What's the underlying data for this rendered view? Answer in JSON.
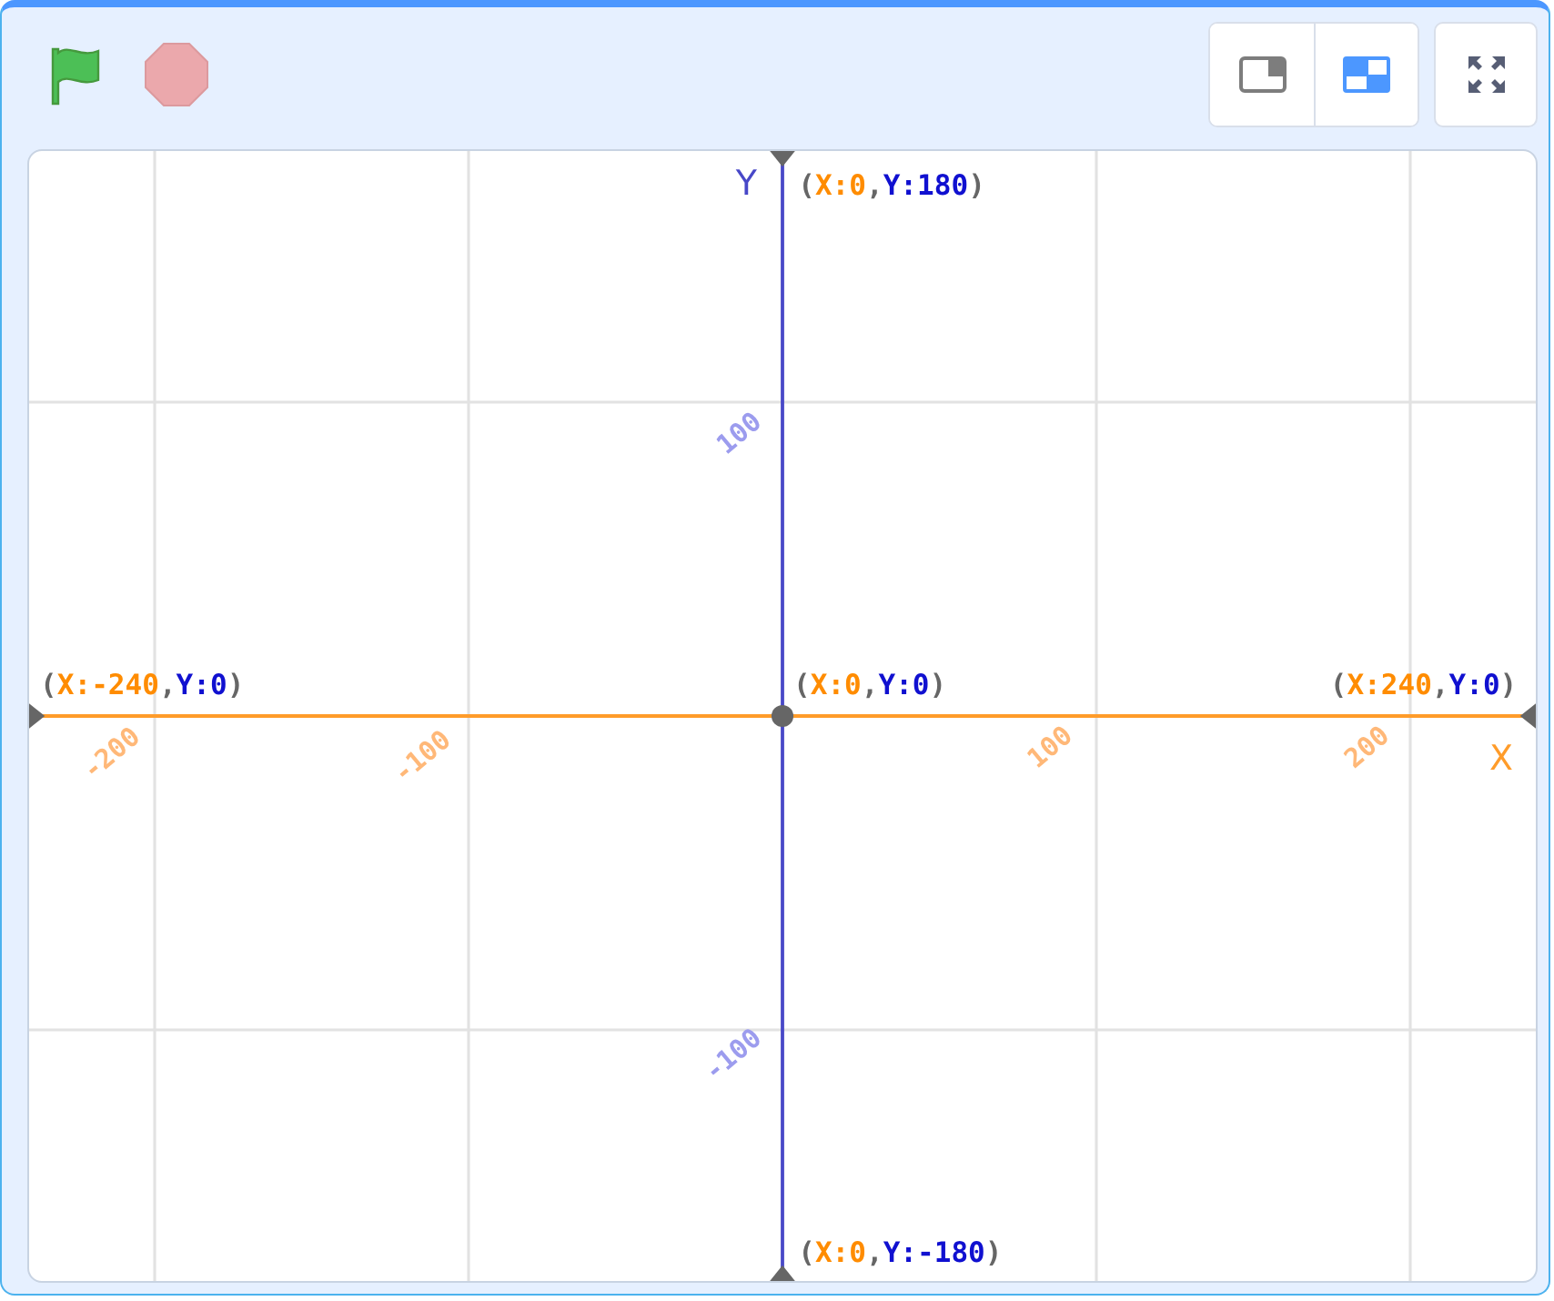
{
  "stage_size_buttons": [
    {
      "selected": false
    },
    {
      "selected": true
    }
  ],
  "stage": {
    "axes": [
      {
        "kind": "y",
        "label": "Y"
      },
      {
        "kind": "x",
        "label": "X"
      }
    ],
    "ticks": [
      {
        "kind": "y",
        "text": "100"
      },
      {
        "kind": "y",
        "text": "-100"
      },
      {
        "kind": "x",
        "text": "-200"
      },
      {
        "kind": "x",
        "text": "-100"
      },
      {
        "kind": "x",
        "text": "100"
      },
      {
        "kind": "x",
        "text": "200"
      }
    ],
    "points": [
      {
        "parts": [
          {
            "kind": "punct",
            "text": "("
          },
          {
            "kind": "x",
            "text": "X:0"
          },
          {
            "kind": "punct",
            "text": ","
          },
          {
            "kind": "y",
            "text": "Y:180"
          },
          {
            "kind": "punct",
            "text": ")"
          }
        ]
      },
      {
        "parts": [
          {
            "kind": "punct",
            "text": "("
          },
          {
            "kind": "x",
            "text": "X:-240"
          },
          {
            "kind": "punct",
            "text": ","
          },
          {
            "kind": "y",
            "text": "Y:0"
          },
          {
            "kind": "punct",
            "text": ")"
          }
        ]
      },
      {
        "parts": [
          {
            "kind": "punct",
            "text": "("
          },
          {
            "kind": "x",
            "text": "X:0"
          },
          {
            "kind": "punct",
            "text": ","
          },
          {
            "kind": "y",
            "text": "Y:0"
          },
          {
            "kind": "punct",
            "text": ")"
          }
        ]
      },
      {
        "parts": [
          {
            "kind": "punct",
            "text": "("
          },
          {
            "kind": "x",
            "text": "X:240"
          },
          {
            "kind": "punct",
            "text": ","
          },
          {
            "kind": "y",
            "text": "Y:0"
          },
          {
            "kind": "punct",
            "text": ")"
          }
        ]
      },
      {
        "parts": [
          {
            "kind": "punct",
            "text": "("
          },
          {
            "kind": "x",
            "text": "X:0"
          },
          {
            "kind": "punct",
            "text": ","
          },
          {
            "kind": "y",
            "text": "Y:-180"
          },
          {
            "kind": "punct",
            "text": ")"
          }
        ]
      }
    ]
  }
}
